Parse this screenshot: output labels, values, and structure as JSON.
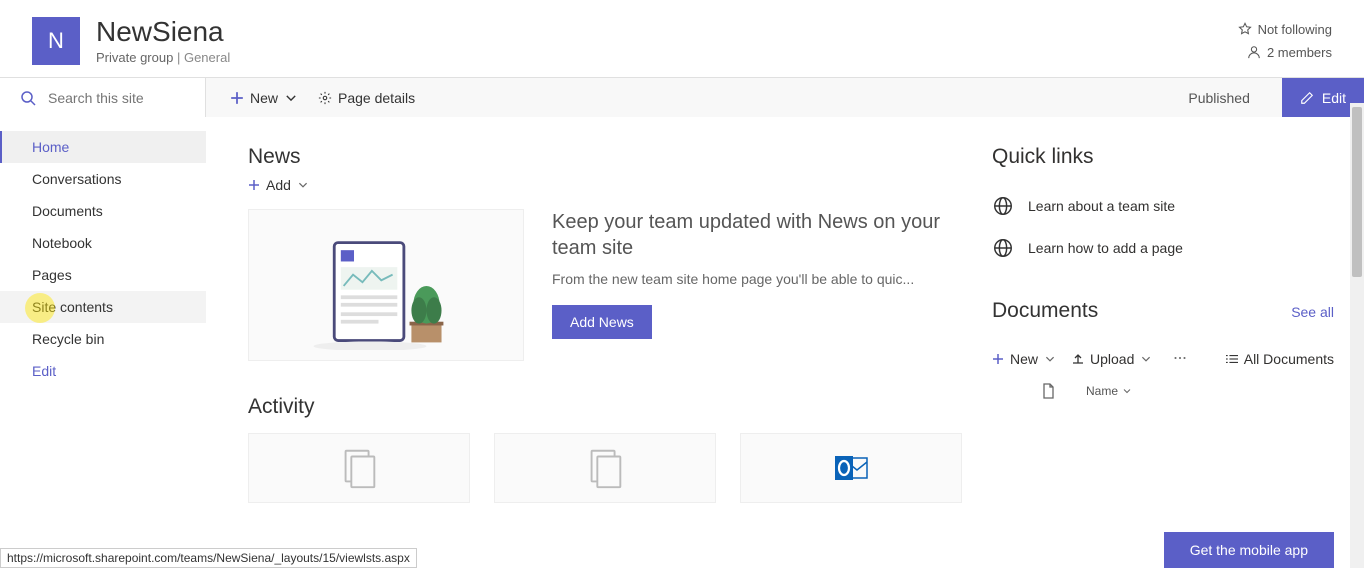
{
  "header": {
    "logo_letter": "N",
    "title": "NewSiena",
    "subtitle_left": "Private group",
    "subtitle_right": "General",
    "follow_label": "Not following",
    "members_label": "2 members"
  },
  "search": {
    "placeholder": "Search this site"
  },
  "cmdbar": {
    "new_label": "New",
    "pagedetails_label": "Page details",
    "published_label": "Published",
    "edit_label": "Edit"
  },
  "sidebar": {
    "items": [
      {
        "label": "Home",
        "active": true
      },
      {
        "label": "Conversations"
      },
      {
        "label": "Documents"
      },
      {
        "label": "Notebook"
      },
      {
        "label": "Pages"
      },
      {
        "label": "Site contents",
        "hovered": true
      },
      {
        "label": "Recycle bin"
      },
      {
        "label": "Edit",
        "edit": true
      }
    ]
  },
  "news": {
    "title": "News",
    "add_label": "Add",
    "headline": "Keep your team updated with News on your team site",
    "desc": "From the new team site home page you'll be able to quic...",
    "add_news_btn": "Add News"
  },
  "activity": {
    "title": "Activity"
  },
  "quicklinks": {
    "title": "Quick links",
    "items": [
      {
        "label": "Learn about a team site"
      },
      {
        "label": "Learn how to add a page"
      }
    ]
  },
  "documents": {
    "title": "Documents",
    "see_all": "See all",
    "new_label": "New",
    "upload_label": "Upload",
    "alldocs_label": "All Documents",
    "name_col": "Name"
  },
  "mobile_btn": "Get the mobile app",
  "statusbar": "https://microsoft.sharepoint.com/teams/NewSiena/_layouts/15/viewlsts.aspx"
}
